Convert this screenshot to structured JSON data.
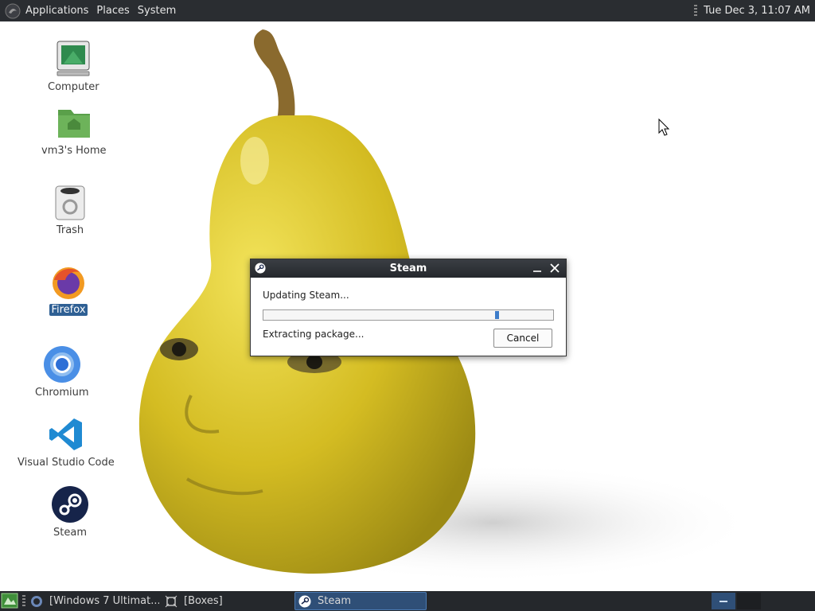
{
  "top_panel": {
    "menus": [
      "Applications",
      "Places",
      "System"
    ],
    "clock": "Tue Dec  3, 11:07 AM"
  },
  "desktop_icons": [
    {
      "label": "Computer",
      "icon": "computer-icon"
    },
    {
      "label": "vm3's Home",
      "icon": "home-folder-icon"
    },
    {
      "label": "Trash",
      "icon": "trash-icon"
    },
    {
      "label": "Firefox",
      "icon": "firefox-icon",
      "selected": true
    },
    {
      "label": "Chromium",
      "icon": "chromium-icon"
    },
    {
      "label": "Visual Studio Code",
      "icon": "vscode-icon"
    },
    {
      "label": "Steam",
      "icon": "steam-icon"
    }
  ],
  "steam_dialog": {
    "title": "Steam",
    "status": "Updating Steam...",
    "substatus": "Extracting package...",
    "cancel_label": "Cancel",
    "progress": 0.81
  },
  "taskbar": {
    "tasks": [
      {
        "label": "[Windows 7 Ultimat...",
        "icon": "vm-icon",
        "active": false
      },
      {
        "label": "[Boxes]",
        "icon": "boxes-icon",
        "active": false
      },
      {
        "label": "Steam",
        "icon": "steam-icon",
        "active": true
      }
    ]
  },
  "colors": {
    "panel": "#2a2d31",
    "selection": "#2f6094",
    "progress": "#3d7cc9",
    "pear": "#d9c227"
  }
}
